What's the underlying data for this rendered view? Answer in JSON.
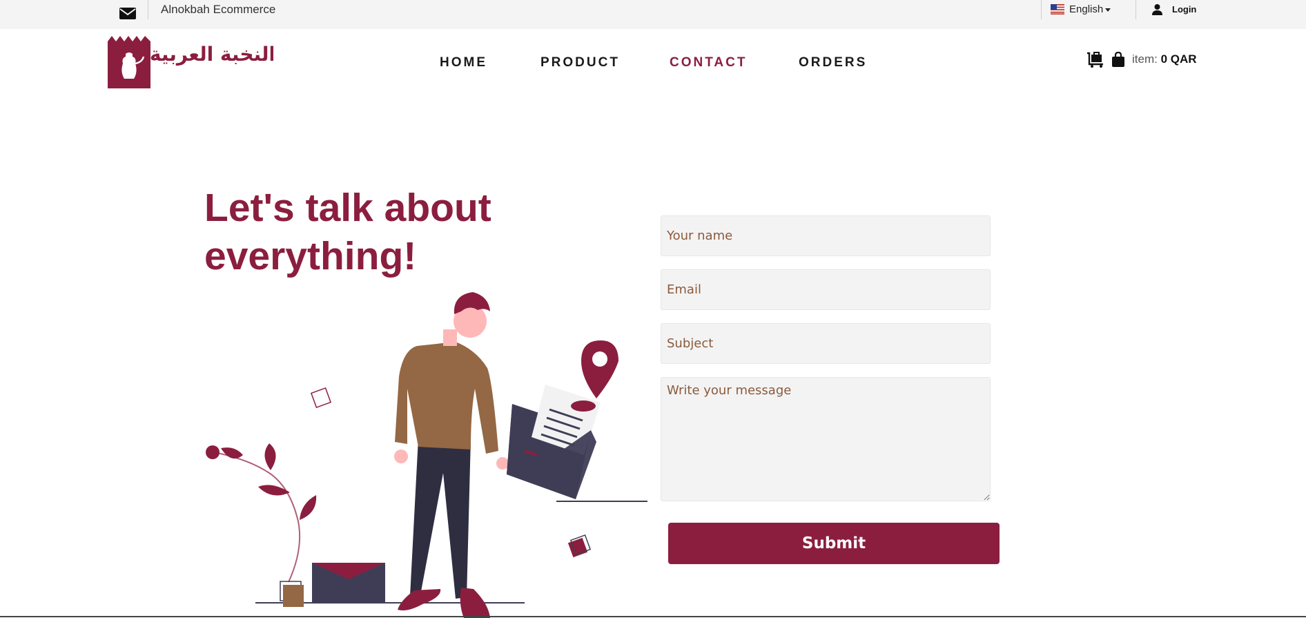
{
  "topbar": {
    "site_name": "Alnokbah Ecommerce",
    "language": "English",
    "login": "Login"
  },
  "header": {
    "nav": [
      "HOME",
      "PRODUCT",
      "CONTACT",
      "ORDERS"
    ],
    "active_nav": "CONTACT",
    "cart_label": "item:",
    "cart_value": "0 QAR"
  },
  "hero": {
    "title_line1": "Let's talk about",
    "title_line2": "everything!"
  },
  "form": {
    "name_placeholder": "Your name",
    "email_placeholder": "Email",
    "subject_placeholder": "Subject",
    "message_placeholder": "Write your message",
    "submit_label": "Submit"
  },
  "colors": {
    "brand": "#8b1e3f",
    "brown": "#946844",
    "navy": "#3f3d56"
  }
}
